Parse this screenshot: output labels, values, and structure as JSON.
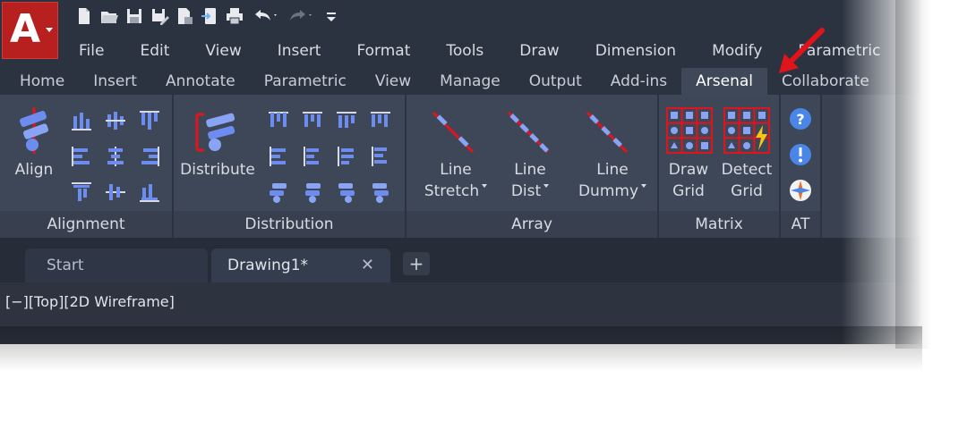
{
  "app_button": {
    "letter": "A"
  },
  "qat": {
    "icons": [
      "new-icon",
      "open-icon",
      "save-icon",
      "save-as-icon",
      "plot-preview-icon",
      "import-icon",
      "print-icon",
      "undo-icon",
      "redo-icon",
      "customize-icon"
    ]
  },
  "menubar": {
    "items": [
      "File",
      "Edit",
      "View",
      "Insert",
      "Format",
      "Tools",
      "Draw",
      "Dimension",
      "Modify",
      "Parametric"
    ]
  },
  "ribbon_tabs": {
    "items": [
      "Home",
      "Insert",
      "Annotate",
      "Parametric",
      "View",
      "Manage",
      "Output",
      "Add-ins",
      "Arsenal",
      "Collaborate"
    ],
    "active": "Arsenal"
  },
  "panels": {
    "alignment": {
      "title": "Alignment",
      "big_button": "Align"
    },
    "distribution": {
      "title": "Distribution",
      "big_button": "Distribute"
    },
    "array": {
      "title": "Array",
      "buttons": [
        {
          "line1": "Line",
          "line2": "Stretch"
        },
        {
          "line1": "Line",
          "line2": "Dist"
        },
        {
          "line1": "Line",
          "line2": "Dummy"
        }
      ]
    },
    "matrix": {
      "title": "Matrix",
      "buttons": [
        {
          "line1": "Draw",
          "line2": "Grid"
        },
        {
          "line1": "Detect",
          "line2": "Grid"
        }
      ]
    },
    "at": {
      "title": "AT"
    }
  },
  "doc_tabs": {
    "start": "Start",
    "drawing": "Drawing1*",
    "close_glyph": "✕",
    "new_tab_glyph": "+"
  },
  "viewport": {
    "label": "[−][Top][2D Wireframe]"
  },
  "colors": {
    "accent_red": "#e0141a",
    "icon_blue": "#6d8cf0",
    "background": "#2b3341"
  }
}
